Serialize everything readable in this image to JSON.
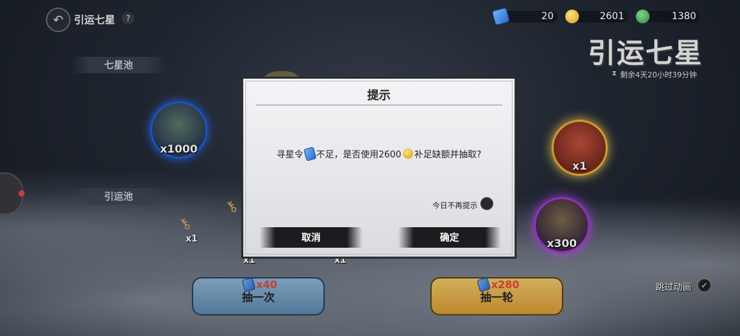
{
  "header": {
    "title": "引运七星",
    "help": "?",
    "back_icon": "↶"
  },
  "resources": {
    "token": "20",
    "gold": "2601",
    "jade": "1380"
  },
  "event": {
    "logo": "引运七星",
    "timer": "剩余4天20小时39分钟"
  },
  "pools": {
    "seven_star": "七星池",
    "yinyun": "引运池"
  },
  "rewards": {
    "blue": "x1000",
    "gold": "x1",
    "purple": "x300",
    "key_counts": [
      "x1",
      "x1",
      "x1"
    ]
  },
  "draw": {
    "once_label": "抽一次",
    "once_cost": "x40",
    "round_label": "抽一轮",
    "round_cost": "x280"
  },
  "skip": {
    "label": "跳过动画",
    "check": "✓"
  },
  "dialog": {
    "title": "提示",
    "msg_part1": "寻星令",
    "msg_part2": "不足，是否使用2600",
    "msg_part3": "补足缺额并抽取?",
    "dont_remind": "今日不再提示",
    "cancel": "取消",
    "confirm": "确定"
  },
  "colors": {
    "cost_red": "#e04b3a",
    "orb_blue": "#1e5fd8",
    "orb_gold": "#e8b530",
    "orb_purple": "#a637d6"
  }
}
